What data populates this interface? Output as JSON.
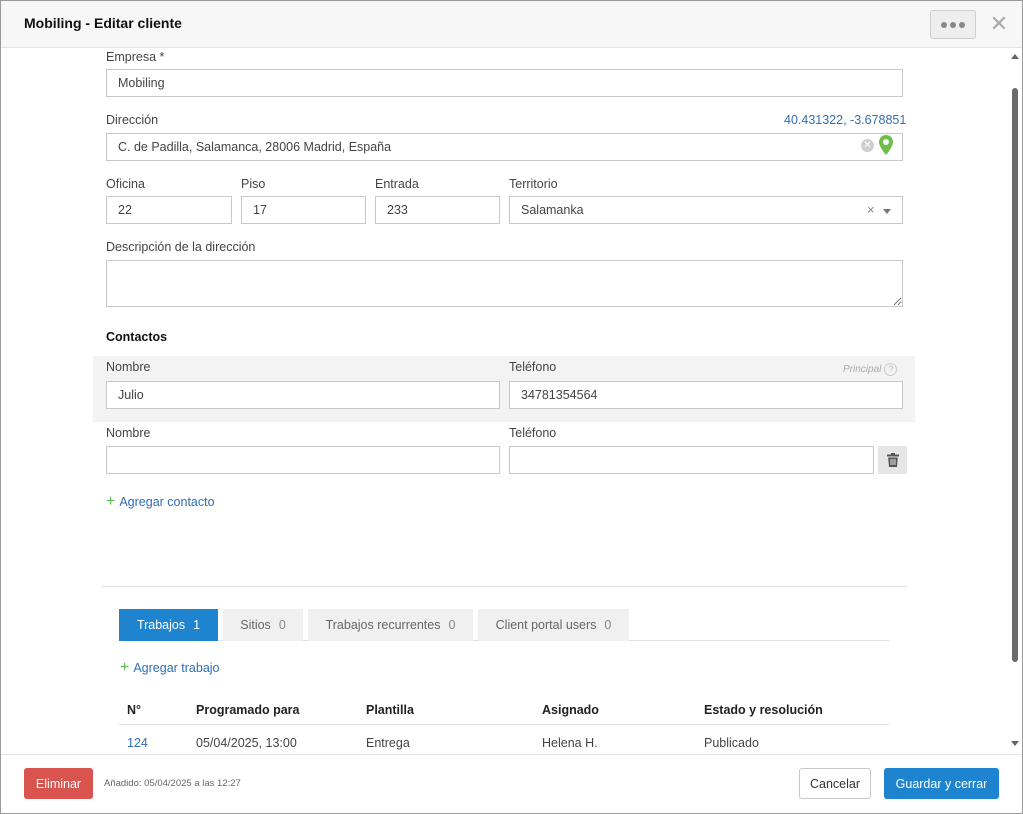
{
  "window": {
    "title": "Mobiling - Editar cliente"
  },
  "form": {
    "empresa": {
      "label": "Empresa *",
      "value": "Mobiling"
    },
    "direccion": {
      "label": "Dirección",
      "value": "C. de Padilla, Salamanca, 28006 Madrid, España",
      "coords": "40.431322, -3.678851"
    },
    "oficina": {
      "label": "Oficina",
      "value": "22"
    },
    "piso": {
      "label": "Piso",
      "value": "17"
    },
    "entrada": {
      "label": "Entrada",
      "value": "233"
    },
    "territorio": {
      "label": "Territorio",
      "value": "Salamanka"
    },
    "descripcion": {
      "label": "Descripción de la dirección",
      "value": ""
    }
  },
  "contacts": {
    "title": "Contactos",
    "principal_label": "Principal",
    "add_label": "Agregar contacto",
    "rows": [
      {
        "name_label": "Nombre",
        "name": "Julio",
        "phone_label": "Teléfono",
        "phone": "34781354564"
      },
      {
        "name_label": "Nombre",
        "name": "",
        "phone_label": "Teléfono",
        "phone": ""
      }
    ]
  },
  "tabs": [
    {
      "label": "Trabajos",
      "count": "1",
      "active": true
    },
    {
      "label": "Sitios",
      "count": "0",
      "active": false
    },
    {
      "label": "Trabajos recurrentes",
      "count": "0",
      "active": false
    },
    {
      "label": "Client portal users",
      "count": "0",
      "active": false
    }
  ],
  "jobs": {
    "add_label": "Agregar trabajo",
    "columns": [
      "N°",
      "Programado para",
      "Plantilla",
      "Asignado",
      "Estado y resolución"
    ],
    "rows": [
      [
        "124",
        "05/04/2025, 13:00",
        "Entrega",
        "Helena H.",
        "Publicado"
      ]
    ]
  },
  "footer": {
    "delete_label": "Eliminar",
    "added_text": "Añadido: 05/04/2025 a las 12:27",
    "cancel_label": "Cancelar",
    "save_label": "Guardar y cerrar"
  },
  "colors": {
    "primary": "#1f84d0",
    "danger": "#d9534f",
    "link": "#2f6fb5",
    "add_plus": "#5cb85c",
    "pin": "#6cc04a"
  },
  "icons": {
    "more": "more-dots-icon",
    "close": "close-icon",
    "clear": "clear-icon",
    "pin": "map-pin-icon",
    "trash": "trash-icon",
    "help": "help-icon",
    "plus": "plus-icon"
  }
}
